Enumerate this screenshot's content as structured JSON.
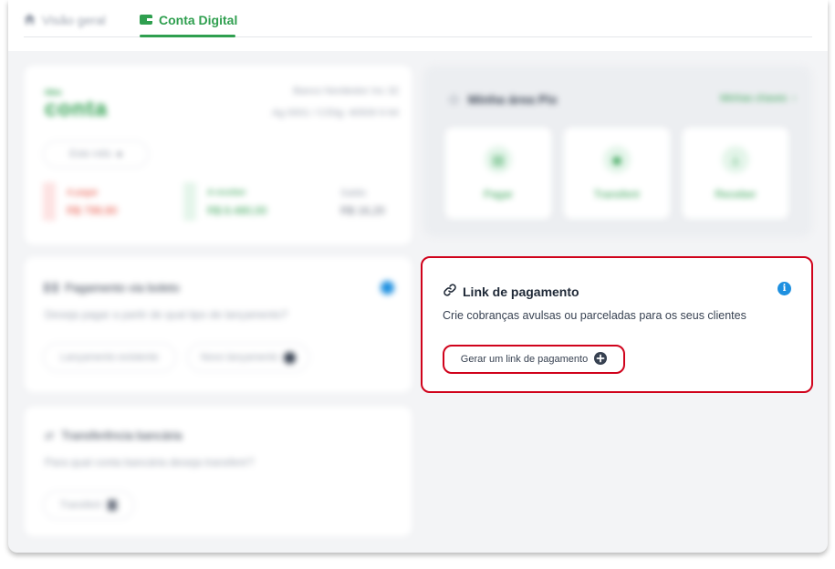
{
  "tabs": {
    "overview_label": "Visão geral",
    "digital_label": "Conta Digital"
  },
  "account_card": {
    "logo_small": "idea",
    "logo_large": "conta",
    "bank_line1": "Banco Nordestor Inc 32",
    "bank_line2": "Ag 0001 / C/Dig: 40509 9 64",
    "period_select": "Este mês",
    "to_pay_label": "A pagar",
    "to_pay_value": "R$ 799,90",
    "to_receive_label": "A receber",
    "to_receive_value": "R$ 8.480,00",
    "balance_label": "Saldo",
    "balance_value": "R$ 16,20"
  },
  "boleto_card": {
    "title": "Pagamento via boleto",
    "subtitle": "Deseja pagar a partir de qual tipo de lançamento?",
    "btn_existing": "Lançamento existente",
    "btn_new": "Novo lançamento"
  },
  "transfer_card": {
    "title": "Transferência bancária",
    "subtitle": "Para qual conta bancária deseja transferir?",
    "btn_transfer": "Transferir"
  },
  "pix_area": {
    "title": "Minha área Pix",
    "keys_link": "Minhas chaves",
    "actions": [
      "Pagar",
      "Transferir",
      "Receber"
    ]
  },
  "link_card": {
    "title": "Link de pagamento",
    "description": "Crie cobranças avulsas ou parceladas para os seus clientes",
    "button_label": "Gerar um link de pagamento",
    "info_glyph": "i"
  },
  "colors": {
    "brand_green": "#2f9f4f",
    "highlight_red": "#d0021b",
    "info_blue": "#1e90e0"
  },
  "icons": {
    "overview": "home-icon",
    "digital": "wallet-icon",
    "link": "chain-link-icon",
    "info": "info-icon",
    "add": "plus-circle-icon"
  }
}
